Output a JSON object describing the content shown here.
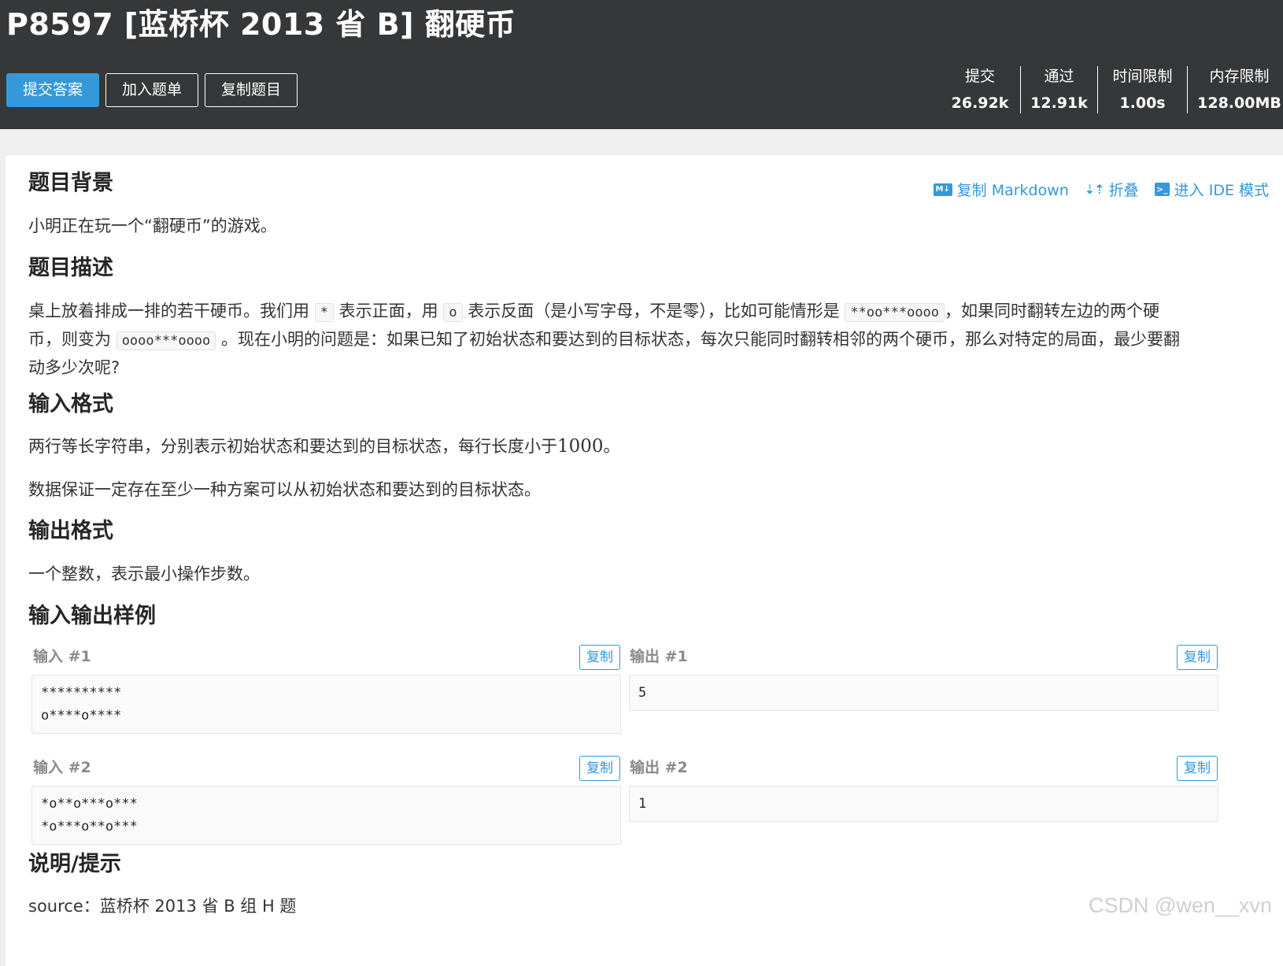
{
  "problem": {
    "title": "P8597 [蓝桥杯 2013 省 B] 翻硬币"
  },
  "actions": {
    "submit": "提交答案",
    "add_list": "加入题单",
    "copy_problem": "复制题目"
  },
  "stats": [
    {
      "label": "提交",
      "value": "26.92k"
    },
    {
      "label": "通过",
      "value": "12.91k"
    },
    {
      "label": "时间限制",
      "value": "1.00s"
    },
    {
      "label": "内存限制",
      "value": "128.00MB"
    }
  ],
  "toolbar": {
    "copy_markdown": "复制 Markdown",
    "fold": "折叠",
    "ide": "进入 IDE 模式",
    "md_icon_text": "M↓",
    "ide_icon_text": ">_"
  },
  "sections": {
    "background_title": "题目背景",
    "background_text": "小明正在玩一个“翻硬币”的游戏。",
    "description_title": "题目描述",
    "desc_p1": "桌上放着排成一排的若干硬币。我们用",
    "desc_code1": "*",
    "desc_p2": "表示正面，用",
    "desc_code2": "o",
    "desc_p3": "表示反面（是小写字母，不是零），比如可能情形是",
    "desc_code3": "**oo***oooo",
    "desc_p4": "，如果同时翻转左边的两个硬",
    "desc_p5": "币，则变为",
    "desc_code4": "oooo***oooo",
    "desc_p6": "。现在小明的问题是：如果已知了初始状态和要达到的目标状态，每次只能同时翻转相邻的两个硬币，那么对特定的局面，最少要翻",
    "desc_p7": "动多少次呢?",
    "input_title": "输入格式",
    "input_p1_a": "两行等长字符串，分别表示初始状态和要达到的目标状态，每行长度小于",
    "input_p1_num": "1000",
    "input_p1_b": "。",
    "input_p2": "数据保证一定存在至少一种方案可以从初始状态和要达到的目标状态。",
    "output_title": "输出格式",
    "output_text": "一个整数，表示最小操作步数。",
    "samples_title": "输入输出样例",
    "hint_title": "说明/提示",
    "hint_text": "source：蓝桥杯 2013 省 B 组 H 题"
  },
  "samples": [
    {
      "input_label": "输入 #1",
      "output_label": "输出 #1",
      "copy": "复制",
      "input_line1": "**********",
      "input_line2": "o****o****",
      "output": "5"
    },
    {
      "input_label": "输入 #2",
      "output_label": "输出 #2",
      "copy": "复制",
      "input_line1": "*o**o***o***",
      "input_line2": "*o***o**o***",
      "output": "1"
    }
  ],
  "watermark": "CSDN @wen__xvn",
  "colors": {
    "header_bg": "#363738",
    "accent": "#3498db",
    "page_bg": "#efefef"
  }
}
